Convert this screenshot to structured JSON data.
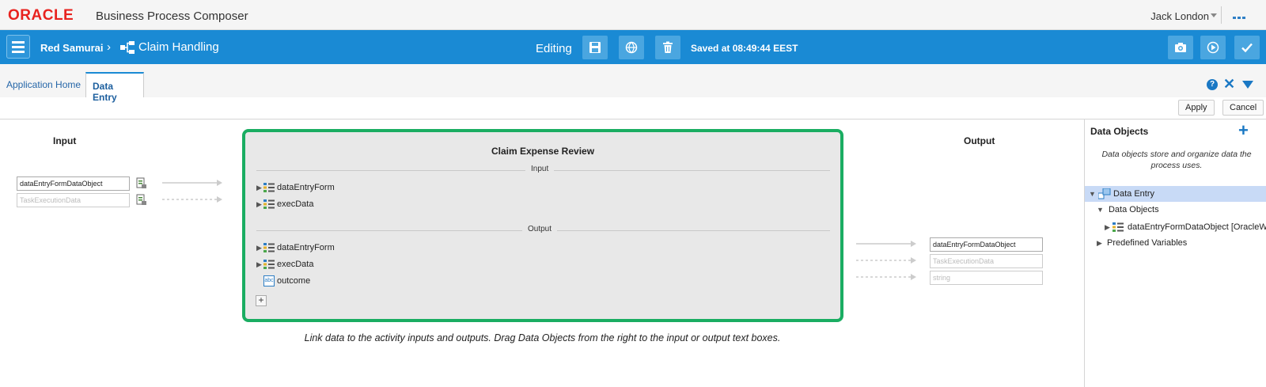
{
  "header": {
    "logo": "ORACLE",
    "product": "Business Process Composer",
    "user": "Jack London"
  },
  "toolbar": {
    "space": "Red Samurai",
    "separator": "›",
    "process": "Claim Handling",
    "mode": "Editing",
    "saved_status": "Saved at 08:49:44 EEST"
  },
  "tabs": [
    {
      "label": "Application Home",
      "active": false
    },
    {
      "label": "Data Entry",
      "active": true
    }
  ],
  "actions": {
    "apply": "Apply",
    "cancel": "Cancel"
  },
  "input_section": {
    "heading": "Input",
    "fields": [
      {
        "value": "dataEntryFormDataObject",
        "placeholder": ""
      },
      {
        "value": "",
        "placeholder": "TaskExecutionData"
      }
    ]
  },
  "activity": {
    "title": "Claim Expense Review",
    "input_label": "Input",
    "output_label": "Output",
    "inputs": [
      {
        "label": "dataEntryForm",
        "icon": "data-object-icon"
      },
      {
        "label": "execData",
        "icon": "data-object-icon"
      }
    ],
    "outputs": [
      {
        "label": "dataEntryForm",
        "icon": "data-object-icon"
      },
      {
        "label": "execData",
        "icon": "data-object-icon"
      },
      {
        "label": "outcome",
        "icon": "string-icon",
        "icon_text": "abc"
      }
    ],
    "add": "+"
  },
  "output_section": {
    "heading": "Output",
    "fields": [
      {
        "value": "dataEntryFormDataObject",
        "placeholder": ""
      },
      {
        "value": "",
        "placeholder": "TaskExecutionData"
      },
      {
        "value": "",
        "placeholder": "string"
      }
    ]
  },
  "hint": "Link data to the activity inputs and outputs. Drag Data Objects from the right to the input or output text boxes.",
  "data_objects_panel": {
    "title": "Data Objects",
    "description": "Data objects store and organize data the process uses.",
    "tree": [
      {
        "label": "Data Entry",
        "selected": true
      },
      {
        "label": "Data Objects",
        "selected": false
      },
      {
        "label": "dataEntryFormDataObject [OracleW",
        "selected": false
      },
      {
        "label": "Predefined Variables",
        "selected": false
      }
    ]
  },
  "colors": {
    "brand_red": "#e8231f",
    "toolbar_blue": "#1a8ad4",
    "activity_border": "#1aad62",
    "selection": "#c8daf6"
  }
}
